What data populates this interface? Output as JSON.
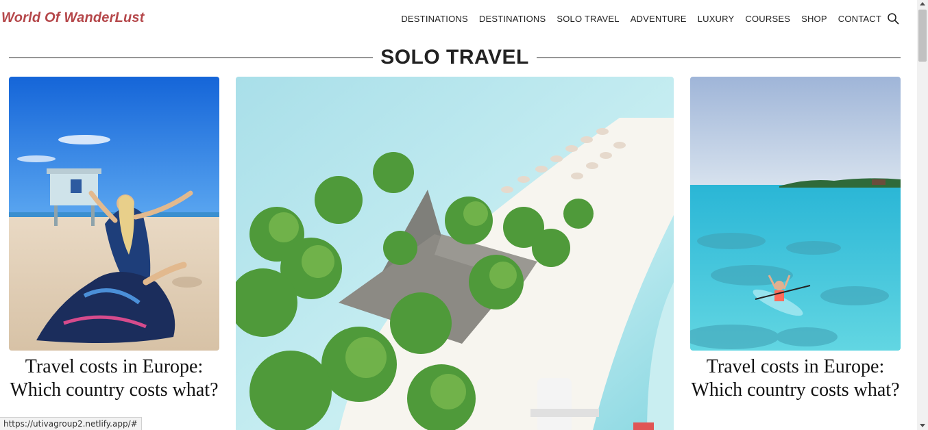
{
  "header": {
    "logo": "World Of WanderLust",
    "nav": [
      "DESTINATIONS",
      "DESTINATIONS",
      "SOLO TRAVEL",
      "ADVENTURE",
      "LUXURY",
      "COURSES",
      "SHOP",
      "CONTACT"
    ],
    "search_icon": "search-icon"
  },
  "section": {
    "title": "SOLO TRAVEL"
  },
  "cards": [
    {
      "title": "Travel costs in Europe: Which country costs what?"
    },
    {
      "title": ""
    },
    {
      "title": "Travel costs in Europe: Which country costs what?"
    }
  ],
  "status_bar": {
    "url": "https://utivagroup2.netlify.app/#"
  },
  "colors": {
    "logo": "#b5474a",
    "text": "#222222",
    "sea": "#5fd0dc",
    "sky": "#1f7fe0"
  }
}
